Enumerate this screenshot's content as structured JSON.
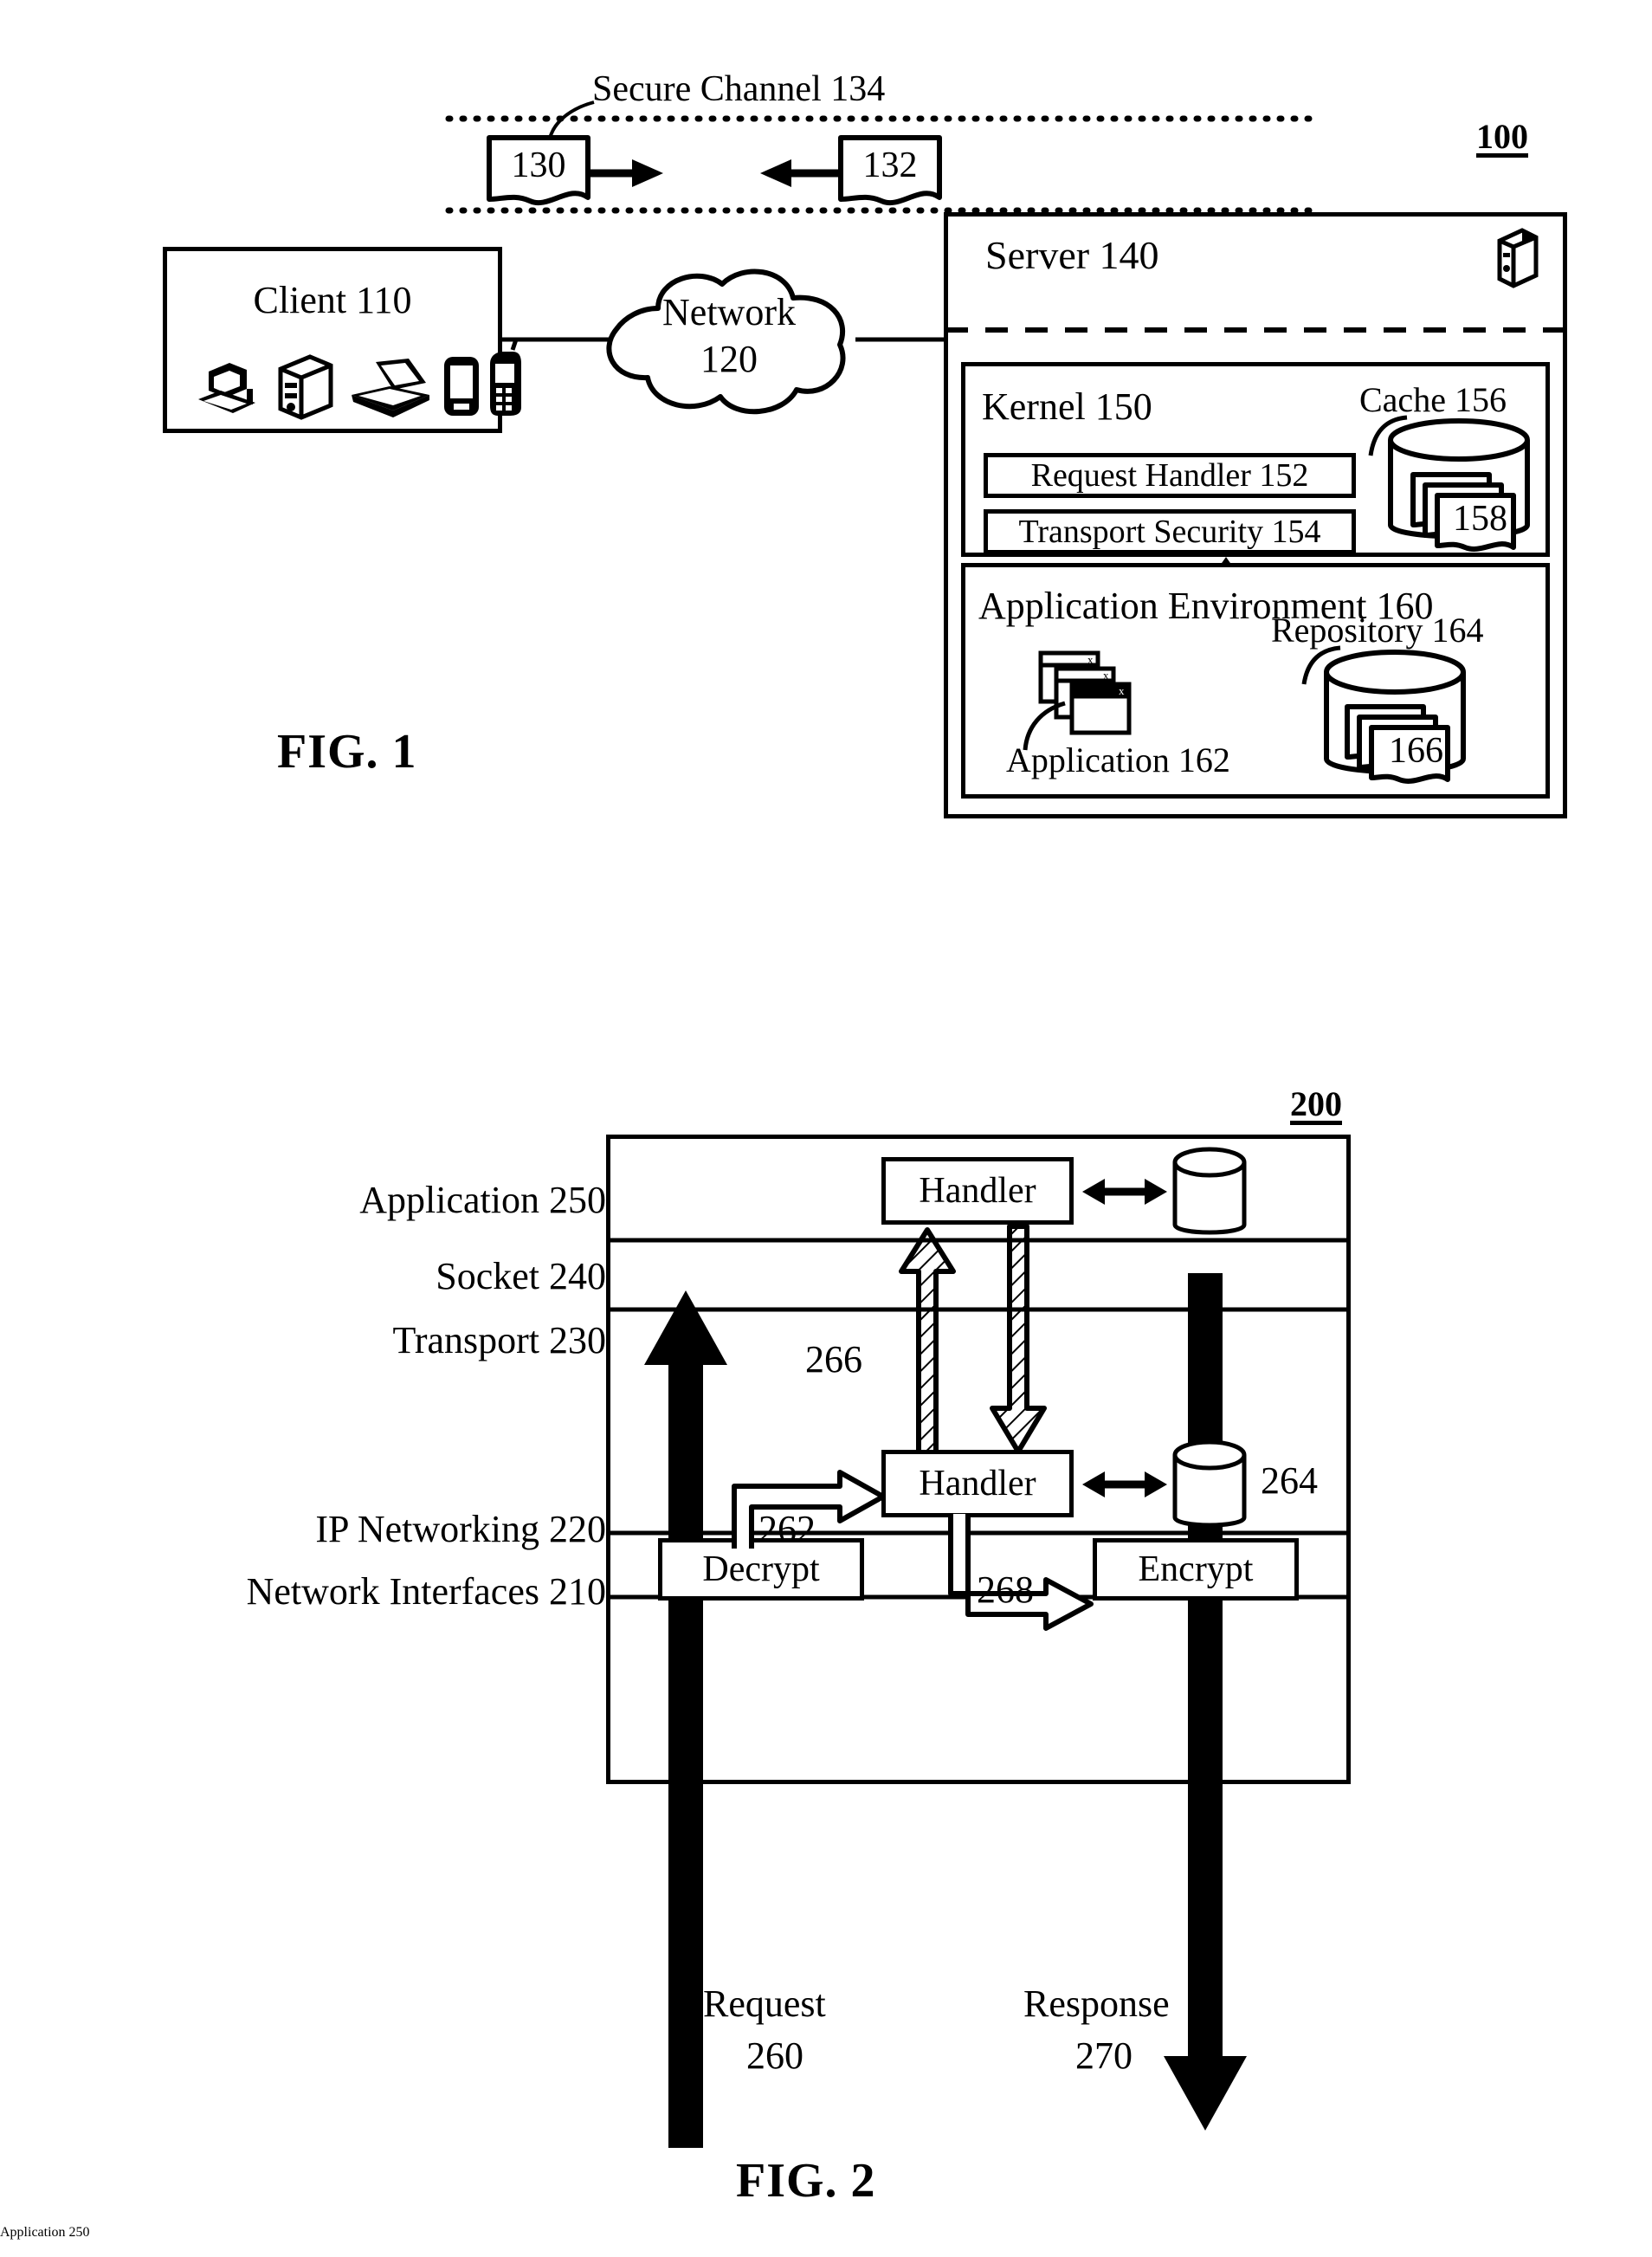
{
  "figure1": {
    "ref_number": "100",
    "caption": "FIG. 1",
    "secure_channel_label": "Secure Channel 134",
    "doc_request": "130",
    "doc_response": "132",
    "client": {
      "label": "Client 110",
      "device_icons": [
        "workstation-icon",
        "desktop-tower-icon",
        "laptop-icon",
        "pda-icon",
        "mobile-phone-icon"
      ]
    },
    "network": {
      "label_line1": "Network",
      "label_line2": "120"
    },
    "server": {
      "label": "Server  140",
      "icon": "server-tower-icon"
    },
    "kernel": {
      "label": "Kernel 150",
      "request_handler": "Request Handler 152",
      "transport_security": "Transport Security 154",
      "cache_label": "Cache 156",
      "cache_docs": "158"
    },
    "app_env": {
      "label": "Application Environment 160",
      "application_label": "Application 162",
      "repository_label": "Repository 164",
      "repository_docs": "166"
    }
  },
  "figure2": {
    "ref_number": "200",
    "caption": "FIG. 2",
    "layers": [
      {
        "label": "Application 250"
      },
      {
        "label": "Socket 240"
      },
      {
        "label": "Transport 230"
      },
      {
        "label": "IP Networking 220"
      },
      {
        "label": "Network Interfaces 210"
      }
    ],
    "app_handler": "Handler",
    "app_store_icon": "database-cylinder-icon",
    "transport_handler": "Handler",
    "transport_store_ref": "264",
    "decrypt": "Decrypt",
    "encrypt": "Encrypt",
    "arrow_262": "262",
    "arrow_266": "266",
    "arrow_268": "268",
    "request_label_line1": "Request",
    "request_label_line2": "260",
    "response_label_line1": "Response",
    "response_label_line2": "270"
  }
}
